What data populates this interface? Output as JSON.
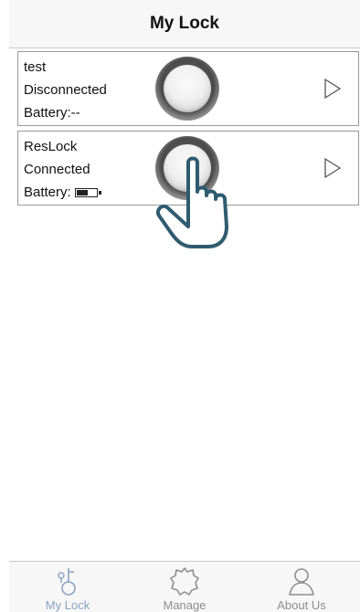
{
  "navbar": {
    "title": "My Lock"
  },
  "locks": [
    {
      "name": "test",
      "status": "Disconnected",
      "battery_text": "Battery:--",
      "battery_shown": false
    },
    {
      "name": "ResLock",
      "status": "Connected",
      "battery_label": "Battery:",
      "battery_shown": true,
      "battery_level": 0.6
    }
  ],
  "tabs": [
    {
      "label": "My Lock",
      "icon": "key-lock-icon",
      "active": true
    },
    {
      "label": "Manage",
      "icon": "gear-icon",
      "active": false
    },
    {
      "label": "About Us",
      "icon": "person-icon",
      "active": false
    }
  ],
  "colors": {
    "active_tab": "#8aa3c0",
    "inactive_tab": "#8e8e8e",
    "hand_stroke": "#2f5b6e"
  }
}
